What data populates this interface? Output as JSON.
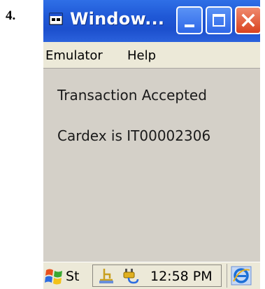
{
  "step": {
    "number": "4."
  },
  "window": {
    "title": "Window...",
    "title_icon": "app-window-icon",
    "buttons": {
      "minimize": "minimize-icon",
      "maximize": "maximize-icon",
      "close": "close-icon"
    }
  },
  "menu": {
    "items": [
      {
        "label": "Emulator"
      },
      {
        "label": "Help"
      }
    ]
  },
  "content": {
    "line1": "Transaction Accepted",
    "line2": "Cardex is IT00002306"
  },
  "taskbar": {
    "start_label": "St",
    "tray_icons": [
      "usb-icon",
      "power-icon"
    ],
    "clock": "12:58 PM",
    "quick_icon": "internet-explorer-icon"
  },
  "colors": {
    "titlebar": "#1f58d6",
    "close": "#d9421f",
    "background": "#d4d0c8",
    "menubar": "#ece9d8"
  }
}
